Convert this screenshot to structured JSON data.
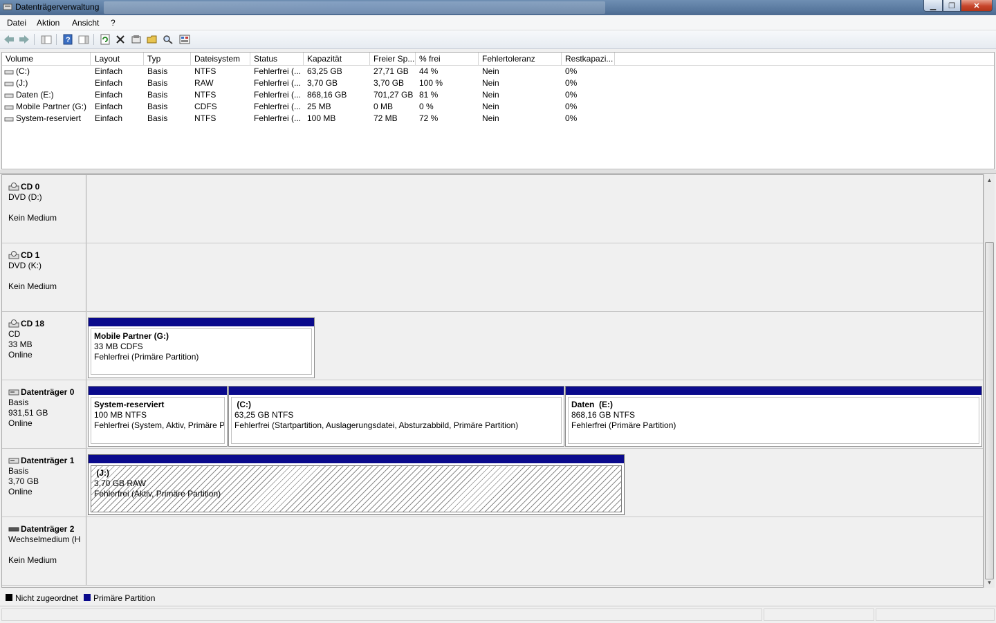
{
  "window": {
    "title": "Datenträgerverwaltung"
  },
  "menu": [
    "Datei",
    "Aktion",
    "Ansicht",
    "?"
  ],
  "toolbar": [
    "back-icon",
    "forward-icon",
    "console-tree-icon",
    "help-icon",
    "properties-pane-icon",
    "refresh-icon",
    "delete-icon",
    "properties-icon",
    "open-icon",
    "explore-icon",
    "disk-settings-icon"
  ],
  "columns": [
    "Volume",
    "Layout",
    "Typ",
    "Dateisystem",
    "Status",
    "Kapazität",
    "Freier Sp...",
    "% frei",
    "Fehlertoleranz",
    "Restkapazi..."
  ],
  "volumes": [
    {
      "name": "(C:)",
      "layout": "Einfach",
      "typ": "Basis",
      "fs": "NTFS",
      "status": "Fehlerfrei (...",
      "cap": "63,25 GB",
      "free": "27,71 GB",
      "pct": "44 %",
      "ft": "Nein",
      "rest": "0%"
    },
    {
      "name": "(J:)",
      "layout": "Einfach",
      "typ": "Basis",
      "fs": "RAW",
      "status": "Fehlerfrei (...",
      "cap": "3,70 GB",
      "free": "3,70 GB",
      "pct": "100 %",
      "ft": "Nein",
      "rest": "0%"
    },
    {
      "name": "Daten (E:)",
      "layout": "Einfach",
      "typ": "Basis",
      "fs": "NTFS",
      "status": "Fehlerfrei (...",
      "cap": "868,16 GB",
      "free": "701,27 GB",
      "pct": "81 %",
      "ft": "Nein",
      "rest": "0%"
    },
    {
      "name": "Mobile Partner (G:)",
      "layout": "Einfach",
      "typ": "Basis",
      "fs": "CDFS",
      "status": "Fehlerfrei (...",
      "cap": "25 MB",
      "free": "0 MB",
      "pct": "0 %",
      "ft": "Nein",
      "rest": "0%"
    },
    {
      "name": "System-reserviert",
      "layout": "Einfach",
      "typ": "Basis",
      "fs": "NTFS",
      "status": "Fehlerfrei (...",
      "cap": "100 MB",
      "free": "72 MB",
      "pct": "72 %",
      "ft": "Nein",
      "rest": "0%"
    }
  ],
  "disks": [
    {
      "name": "CD 0",
      "l1": "DVD (D:)",
      "l2": "",
      "l3": "Kein Medium",
      "icon": "cd-drive-icon"
    },
    {
      "name": "CD 1",
      "l1": "DVD (K:)",
      "l2": "",
      "l3": "Kein Medium",
      "icon": "cd-drive-icon"
    },
    {
      "name": "CD 18",
      "l1": "CD",
      "l2": "33 MB",
      "l3": "Online",
      "icon": "cd-drive-icon",
      "partitions": [
        {
          "name": "Mobile Partner  (G:)",
          "size": "33 MB CDFS",
          "status": "Fehlerfrei (Primäre Partition)"
        }
      ]
    },
    {
      "name": "Datenträger 0",
      "l1": "Basis",
      "l2": "931,51 GB",
      "l3": "Online",
      "icon": "hard-disk-icon",
      "partitions": [
        {
          "name": "System-reserviert",
          "size": "100 MB NTFS",
          "status": "Fehlerfrei (System, Aktiv, Primäre Partition)"
        },
        {
          "name": " (C:)",
          "size": "63,25 GB NTFS",
          "status": "Fehlerfrei (Startpartition, Auslagerungsdatei, Absturzabbild, Primäre Partition)"
        },
        {
          "name": "Daten  (E:)",
          "size": "868,16 GB NTFS",
          "status": "Fehlerfrei (Primäre Partition)"
        }
      ]
    },
    {
      "name": "Datenträger 1",
      "l1": "Basis",
      "l2": "3,70 GB",
      "l3": "Online",
      "icon": "hard-disk-icon",
      "partitions": [
        {
          "name": " (J:)",
          "size": "3,70 GB RAW",
          "status": "Fehlerfrei (Aktiv, Primäre Partition)"
        }
      ]
    },
    {
      "name": "Datenträger 2",
      "l1": "Wechselmedium (H",
      "l2": "",
      "l3": "Kein Medium",
      "icon": "removable-disk-icon"
    }
  ],
  "legend": [
    {
      "label": "Nicht zugeordnet",
      "color": "#000000"
    },
    {
      "label": "Primäre Partition",
      "color": "#0a0a8c"
    }
  ]
}
